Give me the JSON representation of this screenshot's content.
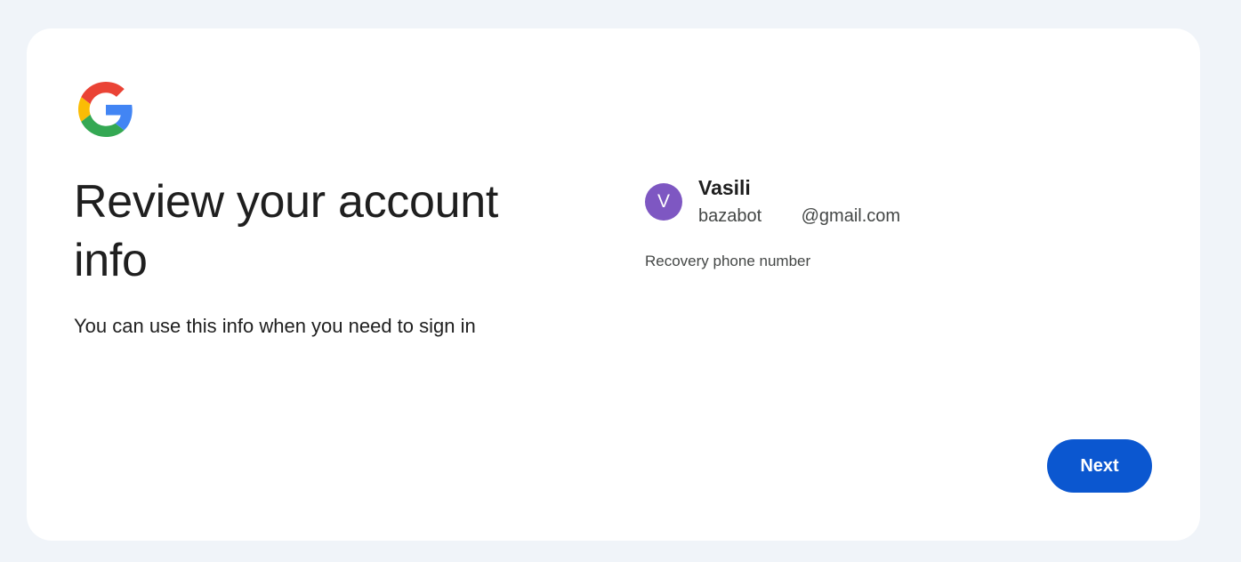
{
  "logo": {
    "icon": "google-g-icon",
    "colors": {
      "red": "#ea4335",
      "yellow": "#fbbc05",
      "green": "#34a853",
      "blue": "#4285f4"
    }
  },
  "header": {
    "title": "Review your account info",
    "subtitle": "You can use this info when you need to sign in"
  },
  "account": {
    "avatar_letter": "V",
    "avatar_color": "#7e57c2",
    "name": "Vasili",
    "email": "bazabot        @gmail.com"
  },
  "recovery": {
    "phone_label": "Recovery phone number"
  },
  "actions": {
    "next_label": "Next",
    "accent": "#0b57d0"
  }
}
